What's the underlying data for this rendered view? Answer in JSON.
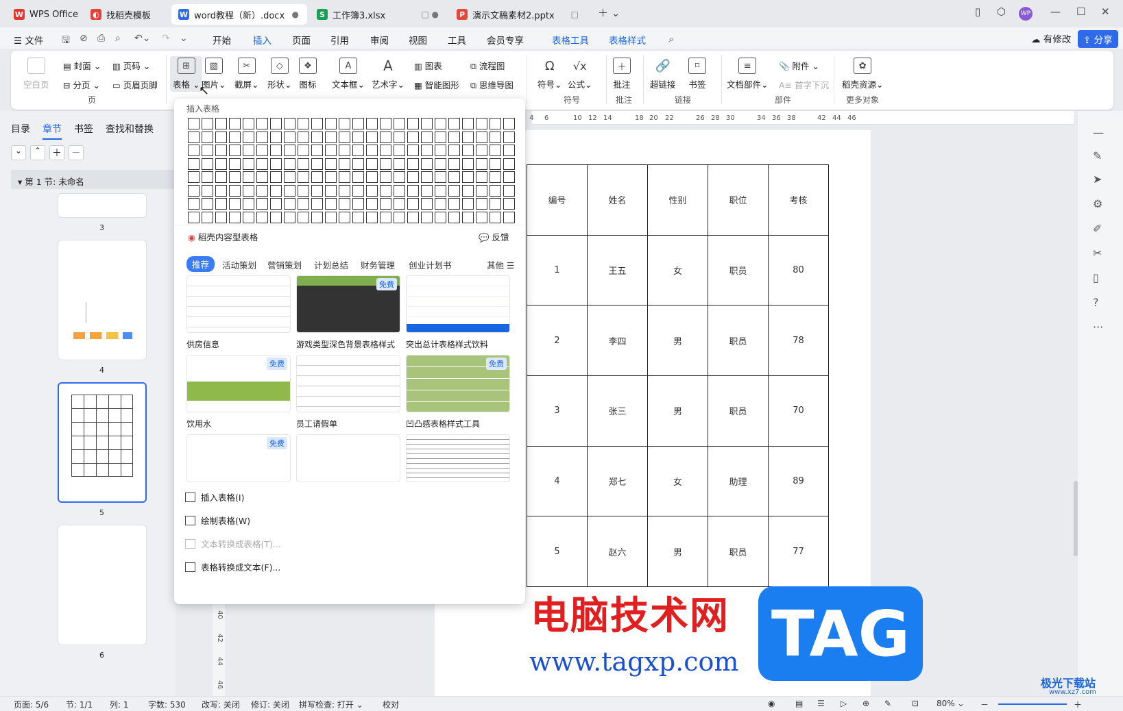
{
  "tabs": [
    {
      "label": "WPS Office",
      "icon": "wps-logo-icon"
    },
    {
      "label": "找稻壳模板",
      "icon": "docer-icon"
    },
    {
      "label": "word教程（新）.docx",
      "icon": "word-doc-icon"
    },
    {
      "label": "工作簿3.xlsx",
      "icon": "sheet-icon"
    },
    {
      "label": "演示文稿素材2.pptx",
      "icon": "ppt-icon"
    }
  ],
  "user_avatar": "WP",
  "menu": {
    "file": "文件",
    "items": [
      "开始",
      "插入",
      "页面",
      "引用",
      "审阅",
      "视图",
      "工具",
      "会员专享",
      "表格工具",
      "表格样式"
    ],
    "active": "插入",
    "revise": "有修改",
    "share": "分享"
  },
  "ribbon": {
    "cover": "封面",
    "page_number": "页码",
    "blank_page": "空白页",
    "page_break": "分页",
    "header_footer": "页眉页脚",
    "table": "表格",
    "picture": "图片",
    "screenshot": "截屏",
    "shape": "形状",
    "icon": "图标",
    "textbox": "文本框",
    "wordart": "艺术字",
    "chart": "图表",
    "flowchart": "流程图",
    "smartart": "智能图形",
    "mindmap": "思维导图",
    "symbol": "符号",
    "formula": "公式",
    "comment": "批注",
    "hyperlink": "超链接",
    "bookmark": "书签",
    "doc_parts": "文档部件",
    "attachment": "附件",
    "dropcap": "首字下沉",
    "docer_resources": "稻壳资源",
    "groups": {
      "page": "页",
      "symbol": "符号",
      "comment": "批注",
      "link": "链接",
      "parts": "部件",
      "more": "更多对象"
    }
  },
  "nav": {
    "tabs": [
      "目录",
      "章节",
      "书签",
      "查找和替换"
    ],
    "active": "章节",
    "section": "第 1 节: 未命名",
    "thumbs": [
      "3",
      "4",
      "5",
      "6"
    ]
  },
  "dropdown": {
    "title": "插入表格",
    "docer_title": "稻壳内容型表格",
    "feedback": "反馈",
    "categories": [
      "推荐",
      "活动策划",
      "营销策划",
      "计划总结",
      "财务管理",
      "创业计划书"
    ],
    "more": "其他",
    "free_badge": "免费",
    "templates": [
      "供房信息",
      "游戏类型深色背景表格样式",
      "突出总计表格样式饮料",
      "饮用水",
      "员工请假单",
      "凹凸感表格样式工具"
    ],
    "actions": [
      "插入表格(I)",
      "绘制表格(W)",
      "文本转换成表格(T)...",
      "表格转换成文本(F)..."
    ]
  },
  "ruler_top": [
    "4",
    "6",
    "10",
    "12",
    "14",
    "18",
    "20",
    "22",
    "26",
    "28",
    "30",
    "34",
    "36",
    "38",
    "42",
    "44",
    "46"
  ],
  "ruler_left": [
    "40",
    "42",
    "44",
    "46"
  ],
  "doc_table": {
    "headers": [
      "编号",
      "姓名",
      "性别",
      "职位",
      "考核"
    ],
    "rows": [
      [
        "1",
        "王五",
        "女",
        "职员",
        "80"
      ],
      [
        "2",
        "李四",
        "男",
        "职员",
        "78"
      ],
      [
        "3",
        "张三",
        "男",
        "职员",
        "70"
      ],
      [
        "4",
        "郑七",
        "女",
        "助理",
        "89"
      ],
      [
        "5",
        "赵六",
        "男",
        "职员",
        "77"
      ]
    ]
  },
  "watermark": {
    "title": "电脑技术网",
    "url": "www.tagxp.com",
    "logo": "TAG",
    "corner": "极光下载站",
    "corner_url": "www.xz7.com"
  },
  "status": {
    "page": "页面: 5/6",
    "section": "节: 1/1",
    "column": "列: 1",
    "words": "字数: 530",
    "revision": "改写: 关闭",
    "track": "修订: 关闭",
    "spell": "拼写检查: 打开",
    "proof": "校对",
    "zoom": "80%"
  }
}
